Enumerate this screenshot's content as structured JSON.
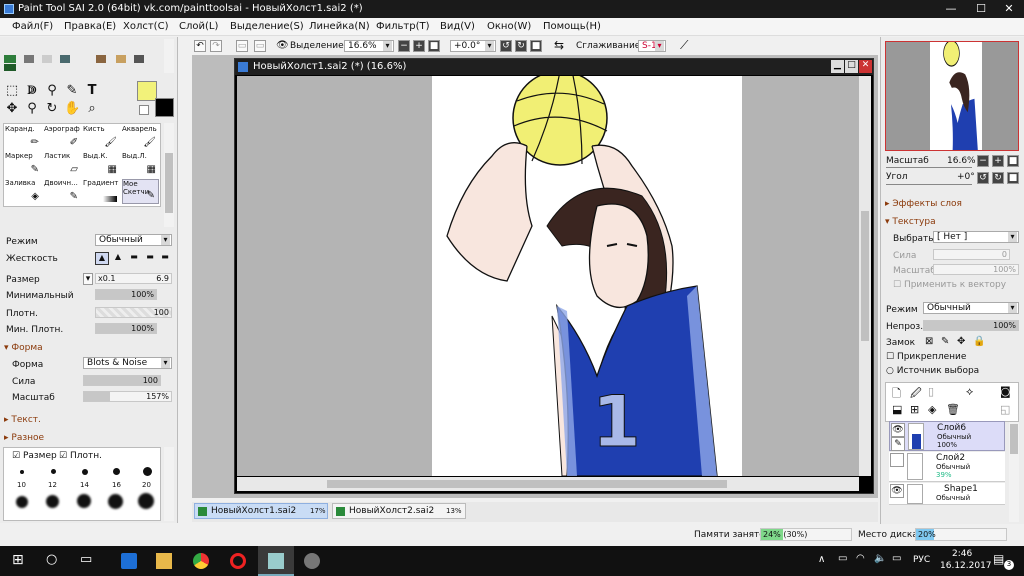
{
  "window": {
    "title": "Paint Tool SAI 2.0 (64bit) vk.com/painttoolsai - НовыйХолст1.sai2 (*)",
    "minimize": "—",
    "maximize": "☐",
    "close": "✕"
  },
  "menu": [
    "Файл(F)",
    "Правка(E)",
    "Холст(C)",
    "Слой(L)",
    "Выделение(S)",
    "Линейка(N)",
    "Фильтр(T)",
    "Вид(V)",
    "Окно(W)",
    "Помощь(H)"
  ],
  "toolbar": {
    "selection_label": "Выделение",
    "zoom_value": "16.6%",
    "rotation_value": "+0.0°",
    "smoothing_label": "Сглаживание",
    "smoothing_value": "S-1"
  },
  "colors": {
    "primary": "#f2f27a",
    "secondary": "#000000",
    "accent": "#3a7bd5"
  },
  "brushes": [
    {
      "label": "Каранд."
    },
    {
      "label": "Аэрограф"
    },
    {
      "label": "Кисть"
    },
    {
      "label": "Акварель"
    },
    {
      "label": "Маркер"
    },
    {
      "label": "Ластик"
    },
    {
      "label": "Выд.К."
    },
    {
      "label": "Выд.Л."
    },
    {
      "label": "Заливка"
    },
    {
      "label": "Двоичн..."
    },
    {
      "label": "Градиент"
    },
    {
      "label": "Мое Скетчи"
    }
  ],
  "tool_props": {
    "mode_label": "Режим",
    "mode_value": "Обычный",
    "hardness_label": "Жесткость",
    "size_label": "Размер",
    "size_mult": "x0.1",
    "size_value": "6.9",
    "min_label": "Минимальный",
    "min_value": "100%",
    "min_pct": 100,
    "density_label": "Плотн.",
    "density_value": "100",
    "density_pct": 100,
    "min_density_label": "Мин. Плотн.",
    "min_density_value": "100%",
    "min_density_pct": 100,
    "shape_section": "Форма",
    "shape_label": "Форма",
    "shape_value": "Blots & Noise",
    "strength_label": "Сила",
    "strength_value": "100",
    "strength_pct": 100,
    "scale_label": "Масштаб",
    "scale_value": "157%",
    "scale_pct": 30,
    "texture_section": "Текст.",
    "misc_section": "Разное",
    "size_check": "Размер",
    "density_check": "Плотн.",
    "brush_sizes": [
      "10",
      "12",
      "14",
      "16",
      "20"
    ]
  },
  "document": {
    "title": "НовыйХолст1.sai2 (*) (16.6%)",
    "number_on_jersey": "1"
  },
  "doc_tabs": [
    {
      "name": "НовыйХолст1.sai2",
      "zoom": "17%"
    },
    {
      "name": "НовыйХолст2.sai2",
      "zoom": "13%"
    }
  ],
  "navigator": {
    "zoom_label": "Масштаб",
    "zoom_value": "16.6%",
    "angle_label": "Угол",
    "angle_value": "+0°"
  },
  "layer_panel": {
    "effects_label": "Эффекты слоя",
    "texture_label": "Текстура",
    "select_label": "Выбрать",
    "select_value": "[ Нет ]",
    "strength_label": "Сила",
    "strength_value": "0",
    "scale_label": "Масштаб",
    "scale_value": "100%",
    "apply_vector": "Применить к вектору",
    "mode_label": "Режим",
    "mode_value": "Обычный",
    "opacity_label": "Непроз.",
    "opacity_value": "100%",
    "opacity_pct": 100,
    "lock_label": "Замок",
    "clip_label": "Прикрепление",
    "source_label": "Источник выбора",
    "layers": [
      {
        "name": "Слой6",
        "mode": "Обычный",
        "opacity": "100%"
      },
      {
        "name": "Слой2",
        "mode": "Обычный",
        "opacity": "39%"
      },
      {
        "name": "Shape1",
        "mode": "Обычный",
        "opacity": ""
      }
    ]
  },
  "status": {
    "memory_label": "Памяти занято",
    "memory_value": "24% (30%)",
    "memory_pct": 24,
    "disk_label": "Место диска",
    "disk_value": "20%",
    "disk_pct": 20
  },
  "taskbar": {
    "lang": "РУС",
    "time": "2:46",
    "date": "16.12.2017",
    "notif": "3"
  }
}
